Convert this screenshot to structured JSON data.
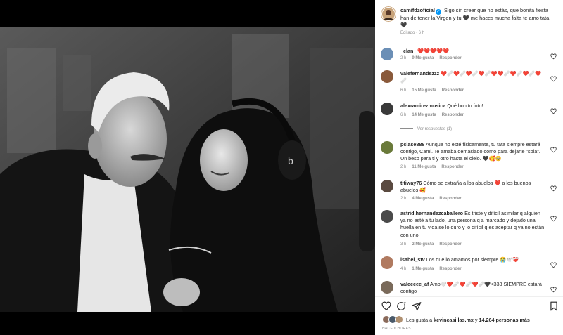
{
  "post": {
    "author": "camifdzoficial",
    "caption": "Sigo sin creer que no estás, que bonita fiesta han de tener la Virgen y tu 🖤 me haces mucha falta te amo tata. 🖤",
    "meta": "Editado · 6 h"
  },
  "comments": [
    {
      "user": "_elan_",
      "text": "❤️❤️❤️❤️❤️",
      "time": "2 h",
      "likes": "9 Me gusta",
      "reply": "Responder",
      "avatar_color": "#6b8fb6"
    },
    {
      "user": "valefernandezzz",
      "text": "❤️🩹❤️🩹❤️🩹❤️🩹❤️❤️🩹❤️🩹❤️🩹❤️🩹",
      "time": "6 h",
      "likes": "15 Me gusta",
      "reply": "Responder",
      "avatar_color": "#8a5a3b"
    },
    {
      "user": "alexramirezmusica",
      "text": "Qué bonito foto!",
      "time": "6 h",
      "likes": "14 Me gusta",
      "reply": "Responder",
      "avatar_color": "#3a3a3a",
      "replies": "Ver respuestas (1)"
    },
    {
      "user": "pclase888",
      "text": "Aunque no esté físicamente, tu tata siempre estará contigo, Cami. Te amaba demasiado como para dejarte \"sola\". Un beso para ti y otro hasta el cielo. 🖤🥰🥹",
      "time": "2 h",
      "likes": "11 Me gusta",
      "reply": "Responder",
      "avatar_color": "#6a7a3a"
    },
    {
      "user": "titiway76",
      "text": "Cómo se extraña a los abuelos ❤️ a los buenos abuelos 🥰",
      "time": "2 h",
      "likes": "4 Me gusta",
      "reply": "Responder",
      "avatar_color": "#5a4a40"
    },
    {
      "user": "astrid.hernandezcaballero",
      "text": "Es triste y difícil asimilar q alguien ya no esté a tu lado, una persona q a marcado y dejado una huella en tu vida se lo duro y lo difícil q es aceptar q ya no están con uno",
      "time": "3 h",
      "likes": "2 Me gusta",
      "reply": "Responder",
      "avatar_color": "#4a4a4a"
    },
    {
      "user": "isabel_stv",
      "text": "Los que lo amamos por siempre 😭🕊️❤️‍🩹",
      "time": "4 h",
      "likes": "1 Me gusta",
      "reply": "Responder",
      "avatar_color": "#b07a60"
    },
    {
      "user": "valeeeee_af",
      "text": "Amo🤍❤️🩹❤️🩹❤️🩹🖤<333 SIEMPRE estará contigo",
      "time": "",
      "likes": "",
      "reply": "",
      "avatar_color": "#7a6a5a"
    }
  ],
  "footer": {
    "likes_prefix": "Les gusta a ",
    "likes_user": "kevincasillas.mx",
    "likes_mid": " y ",
    "likes_count": "14.264 personas más",
    "time": "HACE 6 HORAS"
  },
  "icons": [
    "heart-icon",
    "comment-icon",
    "share-icon",
    "bookmark-icon",
    "verified-icon"
  ],
  "colors": {
    "accent": "#0095f6",
    "meta": "#8e8e8e",
    "heart": "#ed1c24"
  }
}
